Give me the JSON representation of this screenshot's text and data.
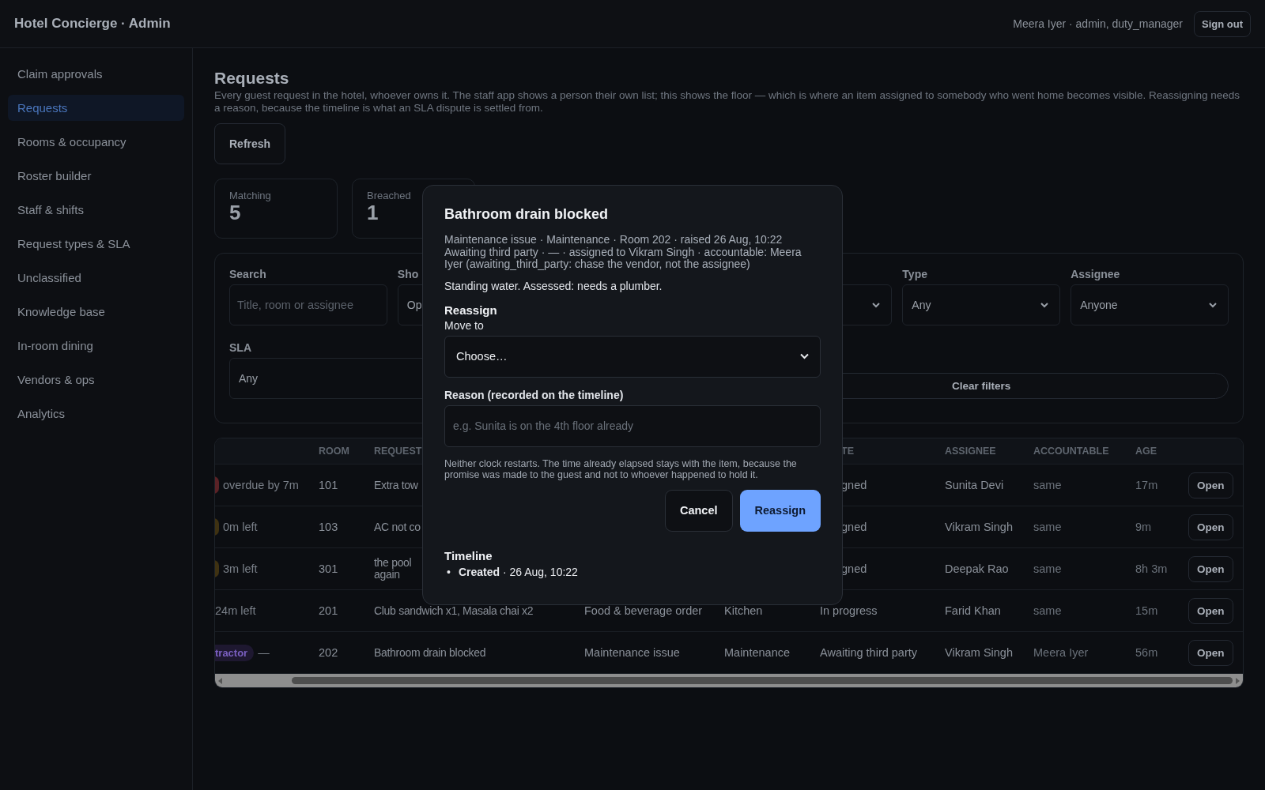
{
  "app": {
    "title": "Hotel Concierge · Admin",
    "user": "Meera Iyer · admin, duty_manager",
    "sign_out": "Sign out"
  },
  "sidebar": {
    "items": [
      {
        "label": "Claim approvals",
        "selected": false
      },
      {
        "label": "Requests",
        "selected": true
      },
      {
        "label": "Rooms & occupancy",
        "selected": false
      },
      {
        "label": "Roster builder",
        "selected": false
      },
      {
        "label": "Staff & shifts",
        "selected": false
      },
      {
        "label": "Request types & SLA",
        "selected": false
      },
      {
        "label": "Unclassified",
        "selected": false
      },
      {
        "label": "Knowledge base",
        "selected": false
      },
      {
        "label": "In-room dining",
        "selected": false
      },
      {
        "label": "Vendors & ops",
        "selected": false
      },
      {
        "label": "Analytics",
        "selected": false
      }
    ]
  },
  "page": {
    "title": "Requests",
    "description": "Every guest request in the hotel, whoever owns it. The staff app shows a person their own list; this shows the floor — which is where an item assigned to somebody who went home becomes visible. Reassigning needs a reason, because the timeline is what an SLA dispute is settled from.",
    "refresh": "Refresh"
  },
  "stats": [
    {
      "label": "Matching",
      "value": "5"
    },
    {
      "label": "Breached",
      "value": "1"
    }
  ],
  "filters": [
    {
      "kind": "text",
      "label": "Search",
      "placeholder": "Title, room or assignee"
    },
    {
      "kind": "select",
      "label": "Sho",
      "value": "Op"
    },
    {
      "kind": "select",
      "chevron": true
    },
    {
      "kind": "select",
      "label": "Type",
      "value": "Any",
      "chevron": true
    },
    {
      "kind": "select",
      "label": "Assignee",
      "value": "Anyone",
      "chevron": true
    }
  ],
  "sla_filter": {
    "label": "SLA",
    "value": "Any"
  },
  "clear_filters": "Clear filters",
  "table": {
    "columns": {
      "room": "ROOM",
      "request": "REQUEST",
      "state": {
        "label": "TE",
        "clipped": true
      },
      "assignee": "ASSIGNEE",
      "accountable": "ACCOUNTABLE",
      "age": "AGE"
    },
    "rows": [
      {
        "sla": {
          "kind": "dot",
          "text": "overdue by 7m",
          "color": "#5a2226"
        },
        "room": "101",
        "request": [
          "Extra tow"
        ],
        "state": {
          "text": "gned",
          "clipped": true
        },
        "assignee": "Sunita Devi",
        "accountable": "same",
        "age": "17m",
        "action": "Open"
      },
      {
        "sla": {
          "kind": "dot",
          "text": "0m left",
          "color": "#3f3212"
        },
        "room": "103",
        "request": [
          "AC not co"
        ],
        "state": {
          "text": "gned",
          "clipped": true
        },
        "assignee": "Vikram Singh",
        "accountable": "same",
        "age": "9m",
        "action": "Open"
      },
      {
        "sla": {
          "kind": "dot",
          "text": "3m left",
          "color": "#3f3212"
        },
        "room": "301",
        "request": [
          "the pool",
          "again"
        ],
        "state": {
          "text": "gned",
          "clipped": true
        },
        "assignee": "Deepak Rao",
        "accountable": "same",
        "age": "8h 3m",
        "action": "Open"
      },
      {
        "sla": {
          "kind": "text",
          "text": "24m left"
        },
        "room": "201",
        "request": [
          "Club sandwich x1, Masala chai x2"
        ],
        "type": "Food & beverage order",
        "dept": "Kitchen",
        "state": {
          "text": "In progress"
        },
        "assignee": "Farid Khan",
        "accountable": "same",
        "age": "15m",
        "action": "Open"
      },
      {
        "sla": {
          "kind": "badge",
          "badge": "tractor",
          "text": "—"
        },
        "room": "202",
        "request": [
          "Bathroom drain blocked"
        ],
        "type": "Maintenance issue",
        "dept": "Maintenance",
        "state": {
          "text": "Awaiting third party"
        },
        "assignee": "Vikram Singh",
        "accountable": "Meera Iyer",
        "age": "56m",
        "action": "Open"
      }
    ]
  },
  "dialog": {
    "title": "Bathroom drain blocked",
    "meta": [
      "Maintenance issue · Maintenance · Room 202 · raised 26 Aug, 10:22",
      "Awaiting third party · — · assigned to Vikram Singh · accountable: Meera Iyer (awaiting_third_party: chase the vendor, not the assignee)"
    ],
    "note": "Standing water. Assessed: needs a plumber.",
    "section": "Reassign",
    "move_label": "Move to",
    "move_value": "Choose…",
    "reason_label": "Reason (recorded on the timeline)",
    "reason_placeholder": "e.g. Sunita is on the 4th floor already",
    "hint": "Neither clock restarts. The time already elapsed stays with the item, because the promise was made to the guest and not to whoever happened to hold it.",
    "buttons": [
      {
        "label": "Cancel",
        "kind": "secondary"
      },
      {
        "label": "Reassign",
        "kind": "primary"
      }
    ],
    "timeline_title": "Timeline",
    "timeline": [
      {
        "bullet": "•",
        "text": "**Created** · 26 Aug, 10:22"
      }
    ]
  }
}
